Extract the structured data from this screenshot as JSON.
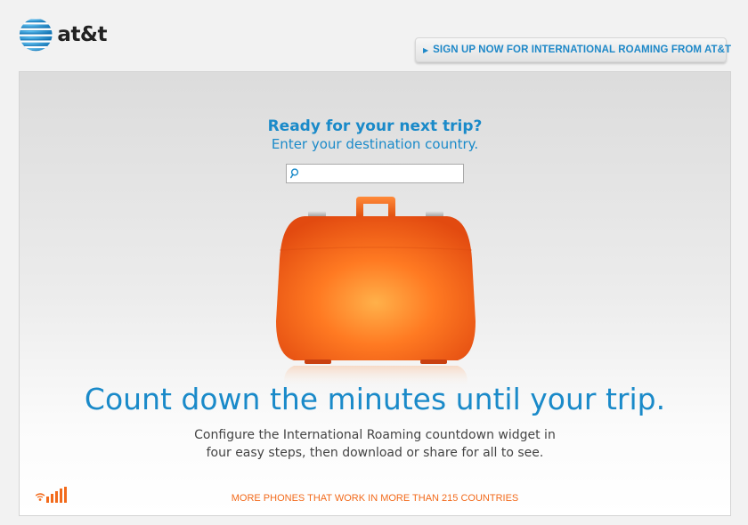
{
  "header": {
    "logo_text": "at&t",
    "signup_label": "SIGN UP NOW FOR INTERNATIONAL ROAMING FROM AT&T"
  },
  "main": {
    "heading": "Ready for your next trip?",
    "subheading": "Enter your destination country.",
    "search": {
      "value": "",
      "placeholder": ""
    },
    "tagline": "Count down the minutes until your trip.",
    "description_line1": "Configure the International Roaming countdown widget in",
    "description_line2": "four easy steps, then download or share for all to see."
  },
  "footer": {
    "link_text": "MORE PHONES THAT WORK IN MORE THAN 215 COUNTRIES"
  },
  "colors": {
    "brand_blue": "#1a8ac9",
    "accent_orange": "#f26a1b",
    "suitcase_orange": "#ff6a1a"
  },
  "icons": [
    "att-globe-icon",
    "arrow-right-icon",
    "search-icon",
    "suitcase-illustration",
    "signal-bars-icon"
  ]
}
